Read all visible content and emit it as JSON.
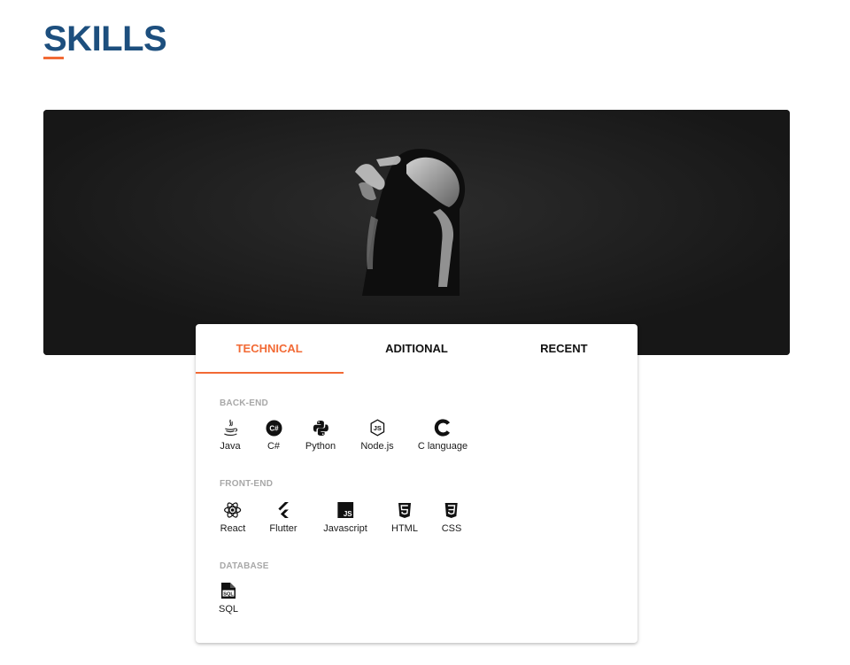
{
  "section": {
    "title": "SKILLS"
  },
  "tabs": [
    {
      "label": "TECHNICAL",
      "active": true
    },
    {
      "label": "ADITIONAL",
      "active": false
    },
    {
      "label": "RECENT",
      "active": false
    }
  ],
  "groups": [
    {
      "label": "BACK-END",
      "items": [
        {
          "label": "Java",
          "icon": "java-icon"
        },
        {
          "label": "C#",
          "icon": "csharp-icon"
        },
        {
          "label": "Python",
          "icon": "python-icon"
        },
        {
          "label": "Node.js",
          "icon": "nodejs-icon"
        },
        {
          "label": "C language",
          "icon": "c-language-icon"
        }
      ]
    },
    {
      "label": "FRONT-END",
      "items": [
        {
          "label": "React",
          "icon": "react-icon"
        },
        {
          "label": "Flutter",
          "icon": "flutter-icon"
        },
        {
          "label": "Javascript",
          "icon": "javascript-icon"
        },
        {
          "label": "HTML",
          "icon": "html5-icon"
        },
        {
          "label": "CSS",
          "icon": "css3-icon"
        }
      ]
    },
    {
      "label": "DATABASE",
      "items": [
        {
          "label": "SQL",
          "icon": "sql-icon"
        }
      ]
    }
  ],
  "colors": {
    "title": "#1d4f7e",
    "accent": "#f26a35",
    "hero_background": "#1b1b1b",
    "group_label": "#a8a8a8"
  }
}
